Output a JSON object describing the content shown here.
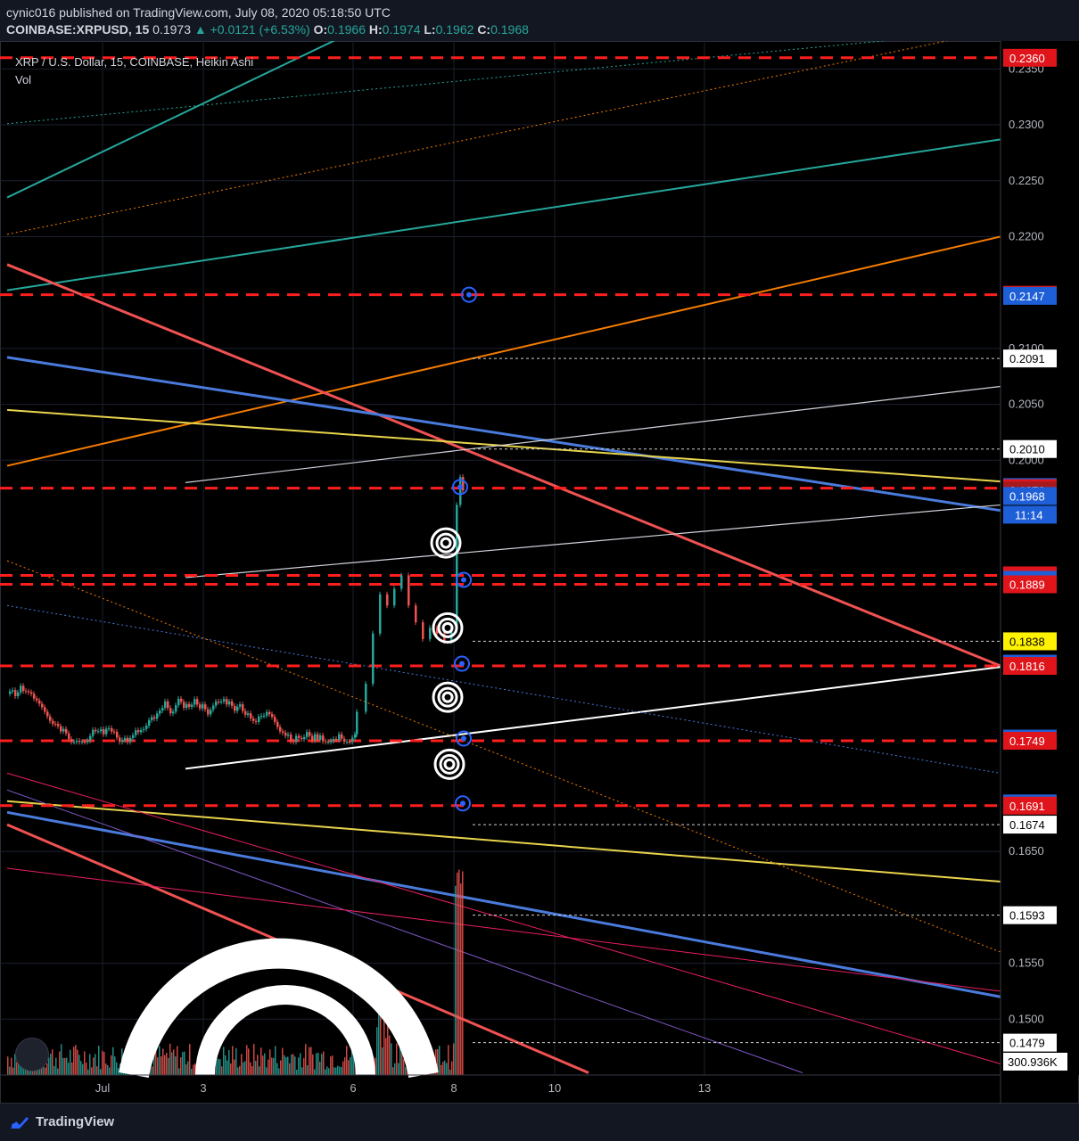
{
  "header": {
    "published": "cynic016 published on TradingView.com, July 08, 2020 05:18:50 UTC",
    "symbol": "COINBASE:XRPUSD, 15",
    "last": "0.1973",
    "change": "▲ +0.0121 (+6.53%)",
    "o_label": "O:",
    "o": "0.1966",
    "h_label": "H:",
    "h": "0.1974",
    "l_label": "L:",
    "l": "0.1962",
    "c_label": "C:",
    "c": "0.1968"
  },
  "legend": {
    "title": "XRP / U.S. Dollar, 15, COINBASE, Heikin Ashi",
    "vol": "Vol"
  },
  "footer": {
    "brand": "TradingView",
    "logo_icon": "tradingview-logo-icon"
  },
  "colors": {
    "up": "#26a69a",
    "down": "#ef5350",
    "red_level": "#ff1e1e",
    "blue_level": "#2962ff",
    "yellow_level": "#ffeb3b",
    "white_level": "#ffffff"
  },
  "chart_data": {
    "type": "candlestick",
    "title": "XRP / U.S. Dollar, 15, COINBASE, Heikin Ashi",
    "ylim": [
      0.145,
      0.2375
    ],
    "y_ticks": [
      "0.2350",
      "0.2300",
      "0.2250",
      "0.2200",
      "0.2100",
      "0.2050",
      "0.2000",
      "0.1650",
      "0.1550",
      "0.1500"
    ],
    "x_ticks": [
      "Jul",
      "3",
      "6",
      "8",
      "10",
      "13"
    ],
    "countdown": "11:14",
    "volume_label": "300.936K",
    "price_labels": [
      {
        "value": "0.2360",
        "color": "red"
      },
      {
        "value": "0.2148",
        "color": "red"
      },
      {
        "value": "0.2147",
        "color": "blue"
      },
      {
        "value": "0.2091",
        "color": "white"
      },
      {
        "value": "0.2010",
        "color": "white"
      },
      {
        "value": "0.1976",
        "color": "blue"
      },
      {
        "value": "0.1975",
        "color": "red"
      },
      {
        "value": "0.1973",
        "color": "darkred"
      },
      {
        "value": "0.1968",
        "color": "blue"
      },
      {
        "value": "0.1897",
        "color": "red"
      },
      {
        "value": "0.1893",
        "color": "blue"
      },
      {
        "value": "0.1889",
        "color": "red"
      },
      {
        "value": "0.1838",
        "color": "yellow"
      },
      {
        "value": "0.1818",
        "color": "blue"
      },
      {
        "value": "0.1816",
        "color": "red"
      },
      {
        "value": "0.1751",
        "color": "blue"
      },
      {
        "value": "0.1749",
        "color": "red"
      },
      {
        "value": "0.1693",
        "color": "blue"
      },
      {
        "value": "0.1691",
        "color": "red"
      },
      {
        "value": "0.1674",
        "color": "white"
      },
      {
        "value": "0.1593",
        "color": "white"
      },
      {
        "value": "0.1479",
        "color": "white"
      }
    ],
    "red_dashed_levels": [
      0.236,
      0.2148,
      0.1975,
      0.1897,
      0.1889,
      0.1816,
      0.1749,
      0.1691
    ],
    "white_dotted_levels": [
      0.2091,
      0.201,
      0.1838,
      0.1674,
      0.1593,
      0.1479
    ]
  }
}
